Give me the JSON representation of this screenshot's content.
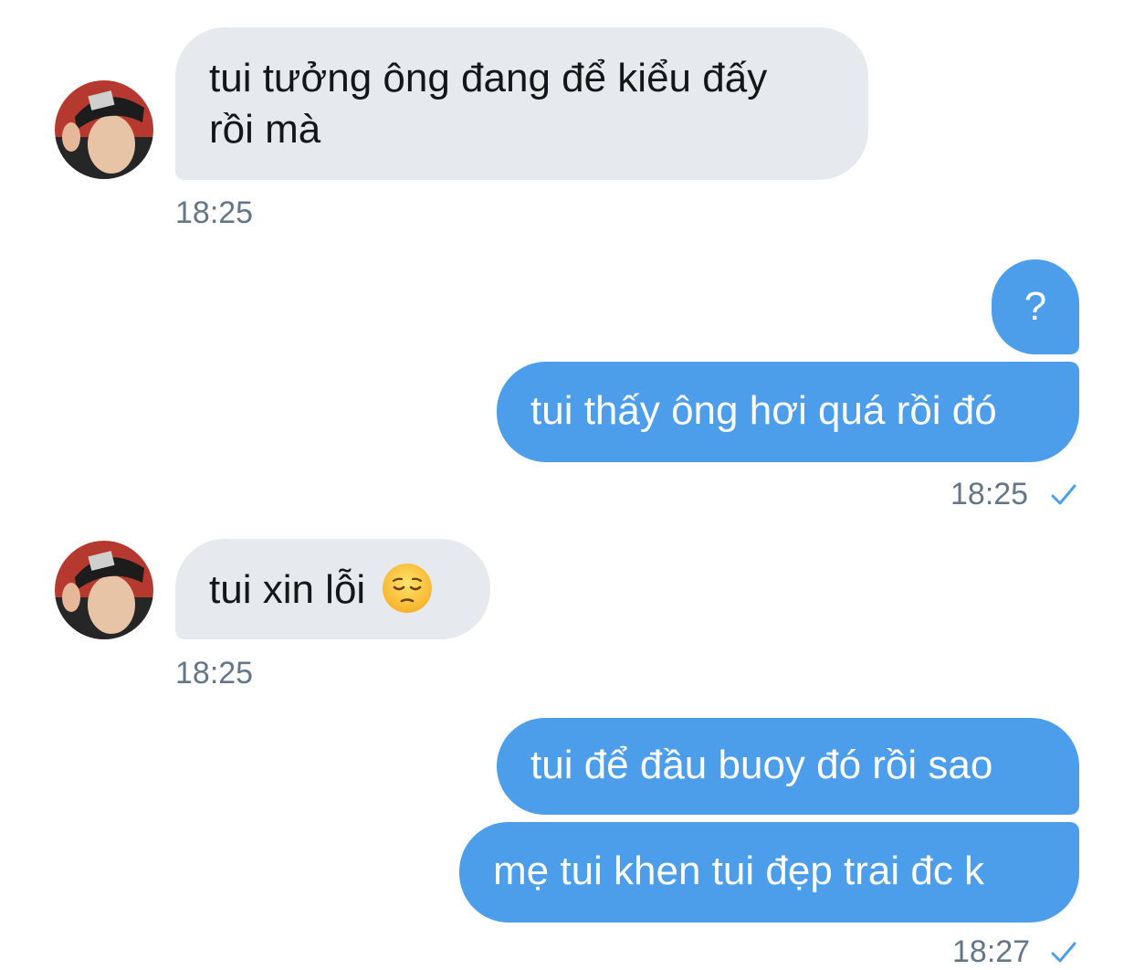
{
  "conversation": {
    "messages": [
      {
        "id": "m1",
        "direction": "incoming",
        "text_line1": "tui tưởng ông đang để kiểu đấy",
        "text_line2": "rồi mà",
        "time": "18:25"
      },
      {
        "id": "m2",
        "direction": "outgoing",
        "text": "?"
      },
      {
        "id": "m3",
        "direction": "outgoing",
        "text": "tui thấy ông hơi quá rồi đó",
        "time": "18:25",
        "status_icon": "check-icon"
      },
      {
        "id": "m4",
        "direction": "incoming",
        "text": "tui xin lỗi",
        "emoji": "pensive-face-emoji",
        "time": "18:25"
      },
      {
        "id": "m5",
        "direction": "outgoing",
        "text": "tui để đầu buoy đó rồi sao"
      },
      {
        "id": "m6",
        "direction": "outgoing",
        "text": "mẹ tui khen tui đẹp trai đc k",
        "time": "18:27",
        "status_icon": "check-icon"
      }
    ]
  },
  "colors": {
    "incoming_bubble": "#e6e9ee",
    "outgoing_bubble": "#4c9eea",
    "timestamp": "#657786",
    "check": "#4c9eea"
  }
}
